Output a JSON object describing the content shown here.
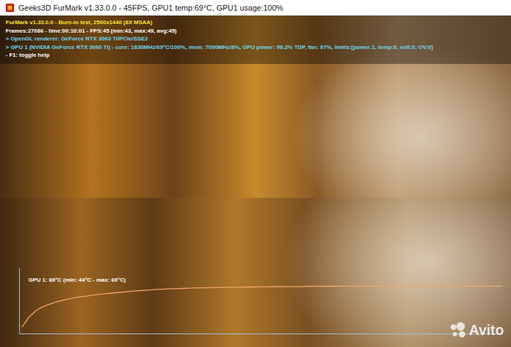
{
  "window": {
    "title": "Geeks3D FurMark v1.33.0.0 - 45FPS, GPU1 temp:69°C, GPU1 usage:100%"
  },
  "hud": {
    "lines": [
      {
        "text": "FurMark v1.33.0.0 - Burn-in test, 2560x1440 (8X MSAA)",
        "kind": "title"
      },
      {
        "text": "Frames:27086 - time:00:10:01 - FPS:45 (min:43, max:49, avg:45)",
        "kind": "stats"
      },
      {
        "text": "> OpenGL renderer: GeForce RTX 3060 Ti/PCIe/SSE2",
        "kind": "info"
      },
      {
        "text": "> GPU 1 (NVIDIA GeForce RTX 3060 Ti) - core: 1830MHz/69°C/100%, mem: 7000MHz/8%, GPU power: 98.2% TDP, fan: 97%, limits:[power:1, temp:0, volt:0, OV:0]",
        "kind": "info"
      },
      {
        "text": "- F1: toggle help",
        "kind": "stats"
      }
    ]
  },
  "graph": {
    "label": "GPU 1: 69°C (min: 44°C - max: 69°C)",
    "values": [
      44,
      50,
      54,
      56.5,
      58,
      59.5,
      60.5,
      61.5,
      62.2,
      62.8,
      63.4,
      64,
      64.4,
      64.8,
      65.2,
      65.6,
      66,
      66.3,
      66.6,
      66.9,
      67.1,
      67.3,
      67.5,
      67.6,
      67.8,
      68,
      68,
      68.1,
      68.2,
      68.3,
      68.3,
      68.4,
      68.5,
      68.5,
      68.6,
      68.6,
      68.7,
      68.7,
      68.8,
      68.8,
      68.8,
      68.9,
      68.9,
      68.9,
      69,
      68.9,
      69,
      69,
      69,
      69,
      69,
      69,
      68.8,
      69,
      69,
      69,
      69,
      69,
      69,
      69,
      69,
      69,
      69,
      69,
      69,
      69,
      69,
      69,
      69,
      69
    ]
  },
  "watermark": {
    "text": "Avito"
  }
}
